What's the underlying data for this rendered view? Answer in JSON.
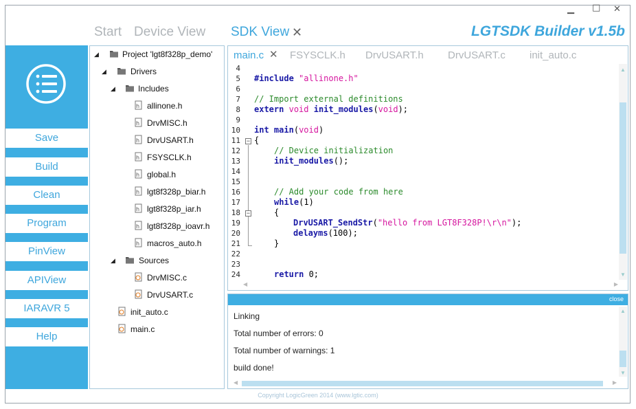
{
  "window": {
    "controls": {
      "minimize": "▁",
      "maximize": "□",
      "close": "✕"
    },
    "app_title": "LGTSDK Builder v1.5b"
  },
  "nav_tabs": [
    {
      "label": "Start"
    },
    {
      "label": "Device View"
    },
    {
      "label": "SDK View"
    }
  ],
  "nav_tab_close": "✕",
  "sidebar": {
    "buttons": [
      "Save",
      "Build",
      "Clean",
      "Program",
      "PinView",
      "APIView",
      "IARAVR 5",
      "Help"
    ]
  },
  "tree": {
    "project": "Project 'lgt8f328p_demo'",
    "drivers": "Drivers",
    "includes": "Includes",
    "include_files": [
      "allinone.h",
      "DrvMISC.h",
      "DrvUSART.h",
      "FSYSCLK.h",
      "global.h",
      "lgt8f328p_biar.h",
      "lgt8f328p_iar.h",
      "lgt8f328p_ioavr.h",
      "macros_auto.h"
    ],
    "sources": "Sources",
    "source_files": [
      "DrvMISC.c",
      "DrvUSART.c"
    ],
    "root_files": [
      "init_auto.c",
      "main.c"
    ]
  },
  "editor": {
    "tabs": [
      "main.c",
      "FSYSCLK.h",
      "DrvUSART.h",
      "DrvUSART.c",
      "init_auto.c"
    ],
    "tab_close": "✕",
    "line_numbers": [
      "4",
      "5",
      "6",
      "7",
      "8",
      "9",
      "10",
      "11",
      "12",
      "13",
      "14",
      "15",
      "16",
      "17",
      "18",
      "19",
      "20",
      "21",
      "22",
      "23",
      "24"
    ],
    "code": {
      "l5_pp": "#include",
      "l5_str": "\"allinone.h\"",
      "l7_cmt": "// Import external definitions",
      "l8_kw": "extern",
      "l8_type": "void",
      "l8_fn": "init_modules",
      "l8_paren_open": "(",
      "l8_arg": "void",
      "l8_rest": ");",
      "l10_kw": "int",
      "l10_fn": "main",
      "l10_paren": "(",
      "l10_arg": "void",
      "l10_close": ")",
      "l11": "{",
      "l12_cmt": "// Device initialization",
      "l13_fn": "init_modules",
      "l13_rest": "();",
      "l17_cmt": "// Add your code from here",
      "l18_kw": "while",
      "l18_rest": "(1)",
      "l19": "{",
      "l20_fn": "DrvUSART_SendStr",
      "l20_paren": "(",
      "l20_str": "\"hello from LGT8F328P!\\r\\n\"",
      "l20_rest": ");",
      "l21_fn": "delayms",
      "l21_rest": "(100);",
      "l22": "}",
      "l25_kw": "return",
      "l25_rest": " 0;"
    }
  },
  "output": {
    "close_label": "close",
    "lines": [
      "Linking",
      "Total number of errors: 0",
      "Total number of warnings: 1",
      "build done!"
    ]
  },
  "footer": "Copyright LogicGreen 2014 (www.lgtic.com)",
  "colors": {
    "accent": "#3eaee2",
    "inactive_tab": "#b0b5b9"
  }
}
